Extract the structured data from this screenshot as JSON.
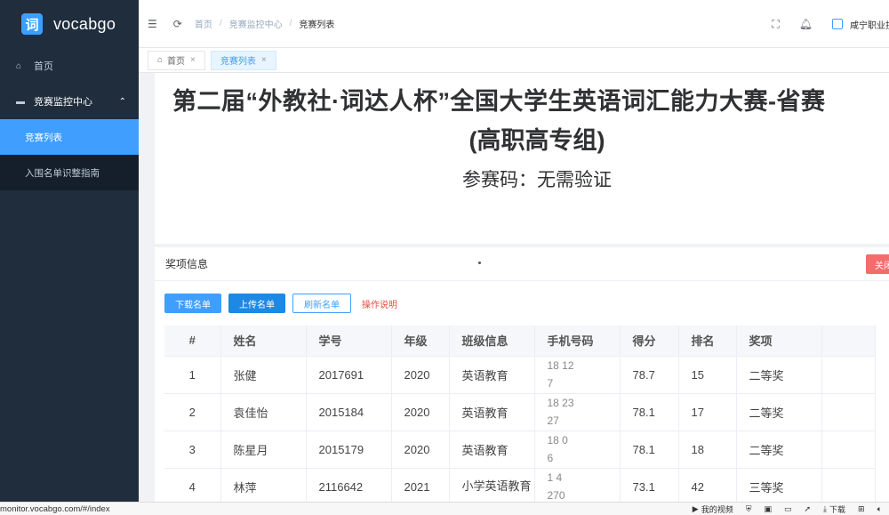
{
  "app": {
    "logo_glyph": "词",
    "name": "vocabgo"
  },
  "sidebar": {
    "home": "首页",
    "parent": "竞赛监控中心",
    "sub_items": [
      {
        "label": "竞赛列表"
      },
      {
        "label": "入围名单识整指南"
      }
    ]
  },
  "header": {
    "crumbs": [
      "首页",
      "竞赛监控中心",
      "竞赛列表"
    ],
    "user": "咸宁职业技"
  },
  "tags": [
    {
      "label": "首页"
    },
    {
      "label": "竞赛列表"
    }
  ],
  "contest": {
    "title_line1": "第二届“外教社·词达人杯”全国大学生英语词汇能力大赛-省赛",
    "title_line2": "(高职高专组)",
    "code_line": "参赛码：无需验证"
  },
  "award_card": {
    "title": "奖项信息",
    "close_label": "关闭",
    "buttons": {
      "download": "下载名单",
      "upload": "上传名单",
      "refresh": "刷新名单",
      "guide": "操作说明"
    }
  },
  "table": {
    "headers": [
      "#",
      "姓名",
      "学号",
      "年级",
      "班级信息",
      "手机号码",
      "得分",
      "排名",
      "奖项",
      ""
    ],
    "rows": [
      {
        "idx": "1",
        "name": "张健",
        "sid": "2017691",
        "grade": "2020",
        "cls": "英语教育",
        "phone1": "18      12",
        "phone2": "7",
        "score": "78.7",
        "rank": "15",
        "award": "二等奖"
      },
      {
        "idx": "2",
        "name": "袁佳怡",
        "sid": "2015184",
        "grade": "2020",
        "cls": "英语教育",
        "phone1": "18      23",
        "phone2": "27",
        "score": "78.1",
        "rank": "17",
        "award": "二等奖"
      },
      {
        "idx": "3",
        "name": "陈星月",
        "sid": "2015179",
        "grade": "2020",
        "cls": "英语教育",
        "phone1": "18      0",
        "phone2": "6",
        "score": "78.1",
        "rank": "18",
        "award": "二等奖"
      },
      {
        "idx": "4",
        "name": "林萍",
        "sid": "2116642",
        "grade": "2021",
        "cls": "小学英语教育",
        "phone1": "1      4",
        "phone2": "270",
        "score": "73.1",
        "rank": "42",
        "award": "三等奖"
      }
    ]
  },
  "statusbar": {
    "url": "monitor.vocabgo.com/#/index",
    "tools": [
      "我的视频",
      "下载"
    ]
  }
}
